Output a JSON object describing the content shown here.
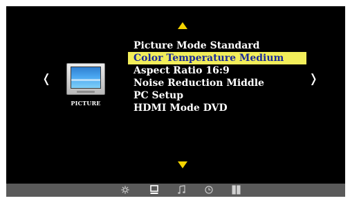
{
  "nav": {
    "up_icon": "triangle-up-icon",
    "down_icon": "triangle-down-icon",
    "left_label": "❬",
    "right_label": "❭",
    "arrow_color": "#f5d400"
  },
  "category": {
    "label": "PICTURE",
    "icon": "tv-picture-icon"
  },
  "menu": {
    "items": [
      {
        "label": "Picture Mode Standard",
        "selected": false
      },
      {
        "label": "Color Temperature Medium",
        "selected": true
      },
      {
        "label": "Aspect Ratio 16:9",
        "selected": false
      },
      {
        "label": "Noise Reduction Middle",
        "selected": false
      },
      {
        "label": "PC Setup",
        "selected": false
      },
      {
        "label": "HDMI Mode DVD",
        "selected": false
      }
    ],
    "highlight_color": "#f2ee5a",
    "highlight_text_color": "#1a2a99"
  },
  "bottom_bar": {
    "icons": [
      {
        "name": "sun-icon",
        "active": false
      },
      {
        "name": "tv-icon",
        "active": true
      },
      {
        "name": "music-note-icon",
        "active": false
      },
      {
        "name": "clock-icon",
        "active": false
      },
      {
        "name": "grid-icon",
        "active": false
      }
    ]
  }
}
